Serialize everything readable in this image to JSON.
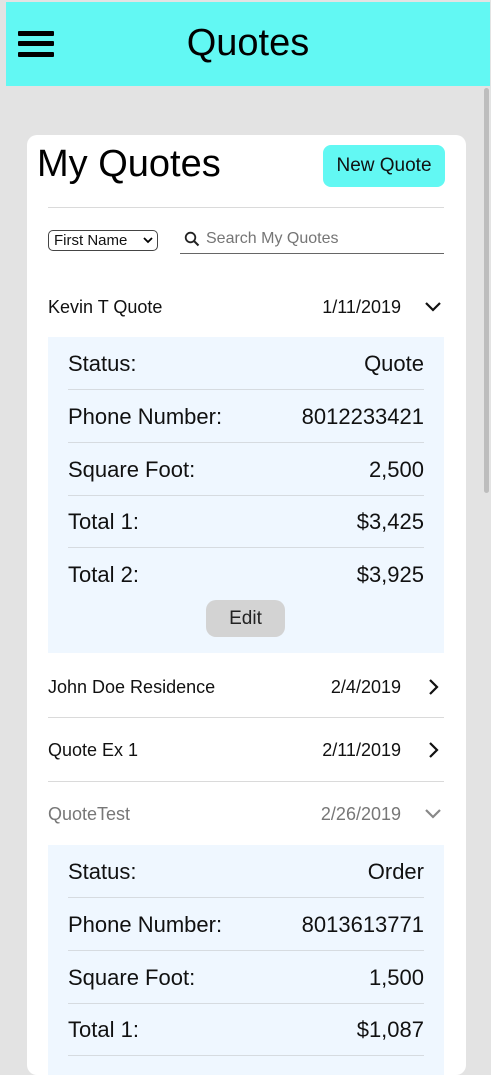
{
  "app": {
    "title": "Quotes"
  },
  "page": {
    "title": "My Quotes",
    "new_quote_label": "New Quote"
  },
  "filter": {
    "sort_selected": "First Name",
    "search_placeholder": "Search My Quotes",
    "search_value": ""
  },
  "detail_labels": {
    "status": "Status:",
    "phone": "Phone Number:",
    "square_foot": "Square Foot:",
    "total1": "Total 1:",
    "total2": "Total 2:",
    "edit": "Edit"
  },
  "quotes": [
    {
      "name": "Kevin T Quote",
      "date": "1/11/2019",
      "expanded": true,
      "status": "Quote",
      "phone": "8012233421",
      "square_foot": "2,500",
      "total1": "$3,425",
      "total2": "$3,925"
    },
    {
      "name": "John Doe Residence",
      "date": "2/4/2019",
      "expanded": false
    },
    {
      "name": "Quote Ex 1",
      "date": "2/11/2019",
      "expanded": false
    },
    {
      "name": "QuoteTest",
      "date": "2/26/2019",
      "expanded": true,
      "status": "Order",
      "phone": "8013613771",
      "square_foot": "1,500",
      "total1": "$1,087"
    }
  ]
}
